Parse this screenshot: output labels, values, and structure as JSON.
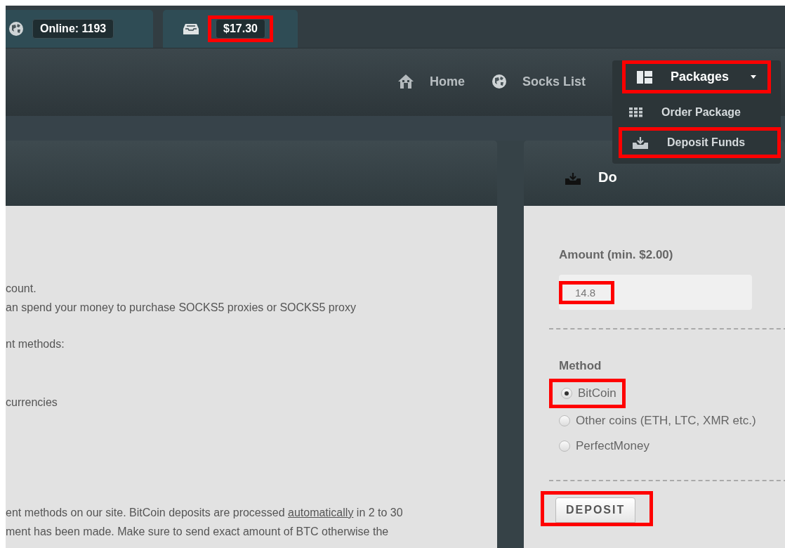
{
  "top_tabs": [
    {
      "kind": "online",
      "label": "Online: 1193",
      "highlighted": false
    },
    {
      "kind": "balance",
      "label": "$17.30",
      "highlighted": true
    }
  ],
  "nav": {
    "items": [
      {
        "kind": "home",
        "label": "Home"
      },
      {
        "kind": "globe",
        "label": "Socks List"
      }
    ],
    "packages": {
      "label": "Packages",
      "expanded": true,
      "highlighted": true
    },
    "dropdown": [
      {
        "kind": "grid",
        "label": "Order Package",
        "highlighted": false
      },
      {
        "kind": "deposit",
        "label": "Deposit Funds",
        "highlighted": true
      }
    ]
  },
  "info_panel": {
    "blocks": [
      {
        "lines": [
          {
            "text": "count."
          },
          {
            "text": "an spend your money to purchase SOCKS5 proxies or SOCKS5 proxy"
          }
        ]
      },
      {
        "lines": [
          {
            "text": "nt methods:"
          }
        ]
      },
      {
        "lines": [
          {
            "text": "currencies"
          }
        ]
      },
      {
        "lines": [
          {
            "text": "ent methods on our site. BitCoin deposits are processed ",
            "link": "automatically",
            "after": " in 2 to 30"
          },
          {
            "text": "ment has been made. Make sure to send exact amount of BTC otherwise the"
          }
        ]
      }
    ]
  },
  "deposit_panel": {
    "title": "Do",
    "amount_label": "Amount (min. $2.00)",
    "amount": {
      "value": "14.8",
      "highlighted": true
    },
    "method_label": "Method",
    "methods": [
      {
        "label": "BitCoin",
        "selected": true,
        "highlighted": true
      },
      {
        "label": "Other coins (ETH, LTC, XMR etc.)",
        "selected": false,
        "highlighted": false
      },
      {
        "label": "PerfectMoney",
        "selected": false,
        "highlighted": false
      }
    ],
    "submit": {
      "label": "DEPOSIT",
      "highlighted": true
    }
  }
}
